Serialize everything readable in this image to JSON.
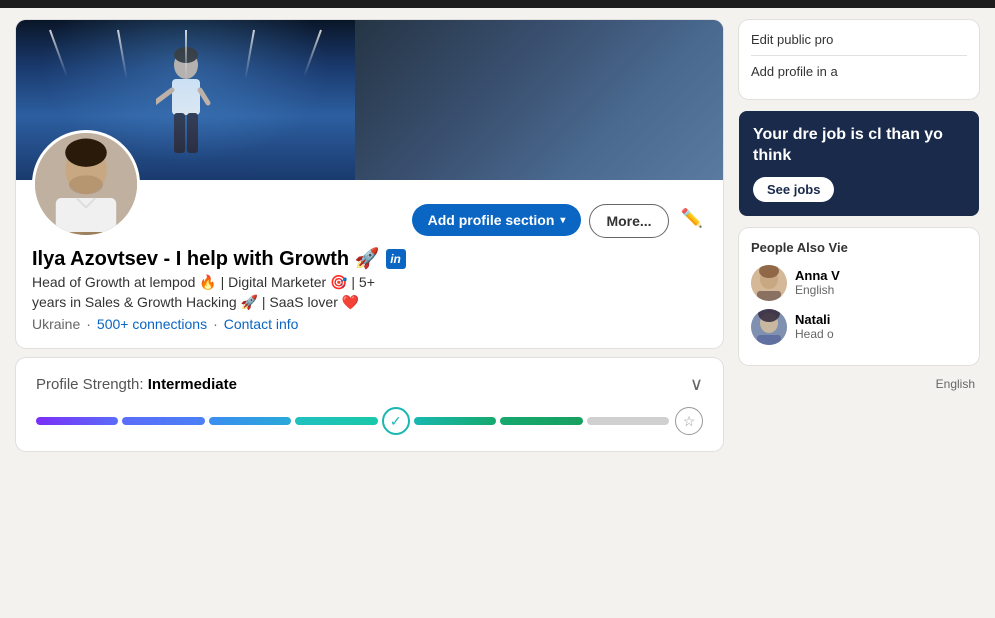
{
  "topbar": {
    "color": "#1d1d1d"
  },
  "profile": {
    "name": "Ilya Azovtsev - I help with Growth 🚀",
    "linkedin_badge": "in",
    "headline_line1": "Head of Growth at lempod 🔥  | Digital Marketer 🎯  | 5+",
    "headline_line2": "years in Sales & Growth Hacking 🚀  | SaaS lover ❤️",
    "location": "Ukraine",
    "connections": "500+ connections",
    "contact_info": "Contact info",
    "add_section_btn": "Add profile section",
    "more_btn": "More...",
    "edit_icon": "✏️"
  },
  "strength": {
    "label": "Profile Strength: ",
    "level": "Intermediate",
    "chevron": "∨"
  },
  "right_panel": {
    "edit_public_label": "Edit public pro",
    "add_profile_label": "Add profile in a",
    "job_ad": {
      "text": "Your dre job is cl than yo think",
      "button": "See jobs"
    },
    "people_also_viewed": "People Also Vie",
    "people": [
      {
        "name": "Anna V",
        "subtitle": "English",
        "avatar_class": "person-avatar-1"
      },
      {
        "name": "Natali",
        "subtitle": "Head o",
        "avatar_class": "person-avatar-2"
      }
    ],
    "language": "English"
  }
}
